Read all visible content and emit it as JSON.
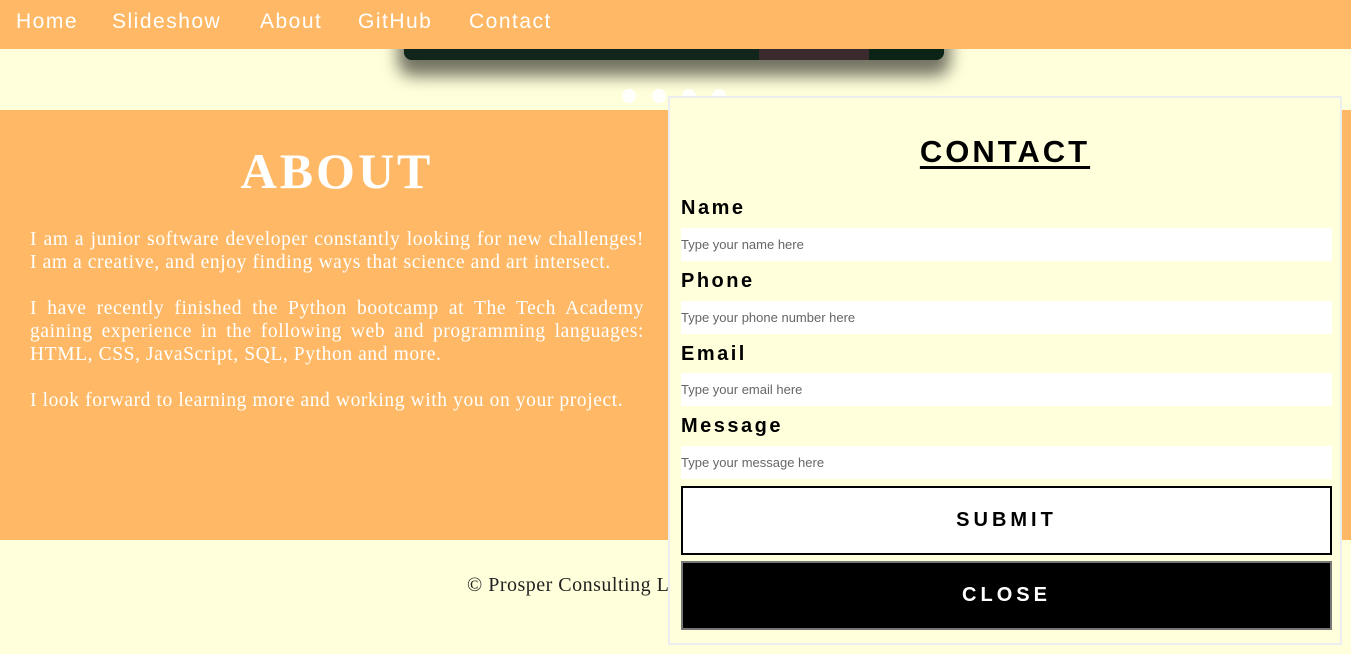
{
  "nav": {
    "items": [
      {
        "label": "Home"
      },
      {
        "label": "Slideshow"
      },
      {
        "label": "About"
      },
      {
        "label": "GitHub"
      },
      {
        "label": "Contact"
      }
    ]
  },
  "slideshow": {
    "dot_count": 4,
    "active_dot": 0
  },
  "about": {
    "title": "ABOUT",
    "paragraphs": [
      "I am a junior software developer constantly looking for new challenges! I am a creative, and enjoy finding ways that science and art intersect.",
      "I have recently finished the Python bootcamp at The Tech Academy gaining experience in the following web and programming languages: HTML, CSS, JavaScript, SQL, Python and more.",
      "I look forward to learning more and working with you on your project."
    ]
  },
  "footer": {
    "text": "© Prosper Consulting L"
  },
  "contact": {
    "title": "CONTACT",
    "fields": {
      "name": {
        "label": "Name",
        "placeholder": "Type your name here",
        "value": ""
      },
      "phone": {
        "label": "Phone",
        "placeholder": "Type your phone number here",
        "value": ""
      },
      "email": {
        "label": "Email",
        "placeholder": "Type your email here",
        "value": ""
      },
      "message": {
        "label": "Message",
        "placeholder": "Type your message here",
        "value": ""
      }
    },
    "submit_label": "SUBMIT",
    "close_label": "CLOSE"
  },
  "colors": {
    "accent": "#FFB966",
    "background": "#FFFFDB",
    "text_on_accent": "#FFFFFF",
    "button_dark": "#000000"
  }
}
